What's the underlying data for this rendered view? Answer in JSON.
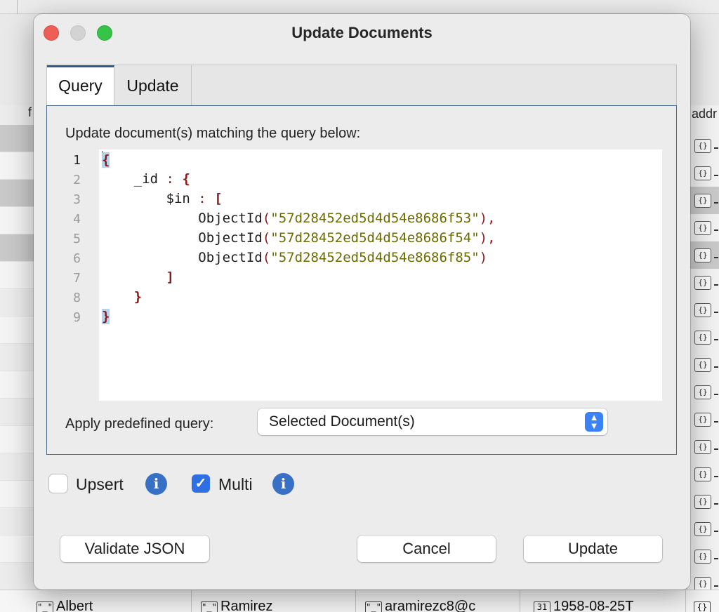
{
  "background": {
    "column_header_left": "f",
    "column_header_right": "addr",
    "bottom_row": {
      "first_name": "Albert",
      "last_name": "Ramirez",
      "email": "aramirezc8@c",
      "date": "1958-08-25T"
    },
    "type_icons": {
      "string": "\"_\"",
      "object": "{}",
      "date": "31"
    }
  },
  "dialog": {
    "title": "Update Documents",
    "tabs": [
      {
        "label": "Query"
      },
      {
        "label": "Update"
      }
    ],
    "query_panel": {
      "label": "Update document(s) matching the query below:",
      "line_numbers": [
        "1",
        "2",
        "3",
        "4",
        "5",
        "6",
        "7",
        "8",
        "9"
      ],
      "code": {
        "open_brace": "{",
        "id_key": "_id",
        "in_key": "$in",
        "colon": ":",
        "open_bracket": "[",
        "close_bracket": "]",
        "close_brace": "}",
        "func_name": "ObjectId",
        "object_ids": [
          "\"57d28452ed5d4d54e8686f53\"",
          "\"57d28452ed5d4d54e8686f54\"",
          "\"57d28452ed5d4d54e8686f85\""
        ]
      },
      "predefined_label": "Apply predefined query:",
      "predefined_value": "Selected Document(s)"
    },
    "options": {
      "upsert_label": "Upsert",
      "upsert_checked": false,
      "multi_label": "Multi",
      "multi_checked": true,
      "info_glyph": "i"
    },
    "buttons": {
      "validate": "Validate JSON",
      "cancel": "Cancel",
      "update": "Update"
    }
  },
  "colors": {
    "accent": "#2f6fe4",
    "info": "#3770c4",
    "brace": "#8b1a1a",
    "string": "#6b6b00",
    "panel_border": "#466a8e"
  }
}
